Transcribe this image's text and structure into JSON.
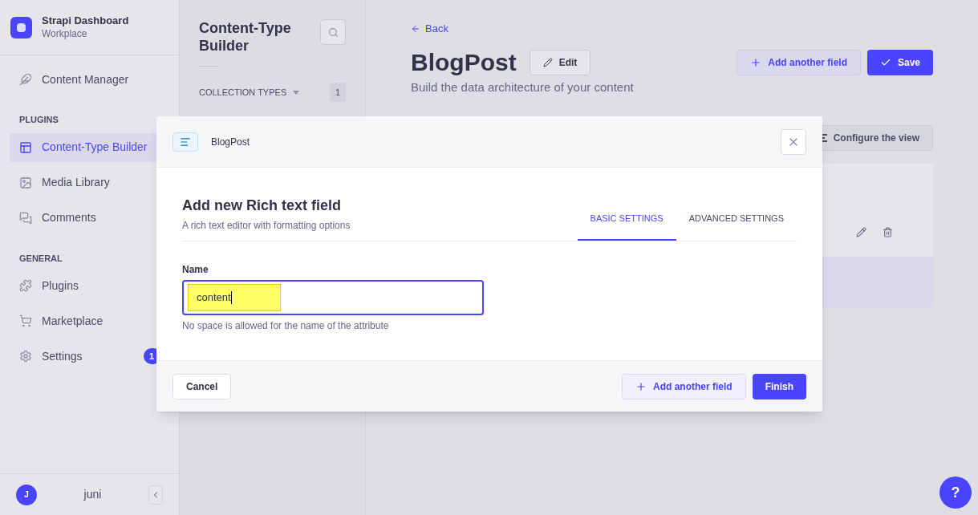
{
  "sidebar": {
    "brand": {
      "title": "Strapi Dashboard",
      "subtitle": "Workplace"
    },
    "sections": [
      {
        "items": [
          {
            "label": "Content Manager",
            "kind": "feather",
            "selected": false
          }
        ]
      },
      {
        "heading": "PLUGINS",
        "items": [
          {
            "label": "Content-Type Builder",
            "kind": "layout",
            "selected": true
          },
          {
            "label": "Media Library",
            "kind": "image",
            "selected": false
          },
          {
            "label": "Comments",
            "kind": "chat",
            "selected": false
          }
        ]
      },
      {
        "heading": "GENERAL",
        "items": [
          {
            "label": "Plugins",
            "kind": "puzzle",
            "selected": false
          },
          {
            "label": "Marketplace",
            "kind": "cart",
            "selected": false
          },
          {
            "label": "Settings",
            "kind": "settings",
            "selected": false,
            "badge": "1"
          }
        ]
      }
    ],
    "user": {
      "initial": "J",
      "name": "juni"
    }
  },
  "subnav": {
    "title": "Content-Type Builder",
    "section": "COLLECTION TYPES",
    "count": "1"
  },
  "header": {
    "back": "Back",
    "title": "BlogPost",
    "edit": "Edit",
    "subtitle": "Build the data architecture of your content",
    "add_button": "Add another field",
    "save": "Save"
  },
  "toolbar": {
    "configure": "Configure the view"
  },
  "modal": {
    "breadcrumb": "BlogPost",
    "title": "Add new Rich text field",
    "description": "A rich text editor with formatting options",
    "tabs": [
      {
        "label": "BASIC SETTINGS",
        "selected": true
      },
      {
        "label": "ADVANCED SETTINGS",
        "selected": false
      }
    ],
    "field": {
      "label": "Name",
      "value": "content",
      "hint": "No space is allowed for the name of the attribute"
    },
    "cancel": "Cancel",
    "add_button": "Add another field",
    "finish": "Finish"
  },
  "help": "?"
}
